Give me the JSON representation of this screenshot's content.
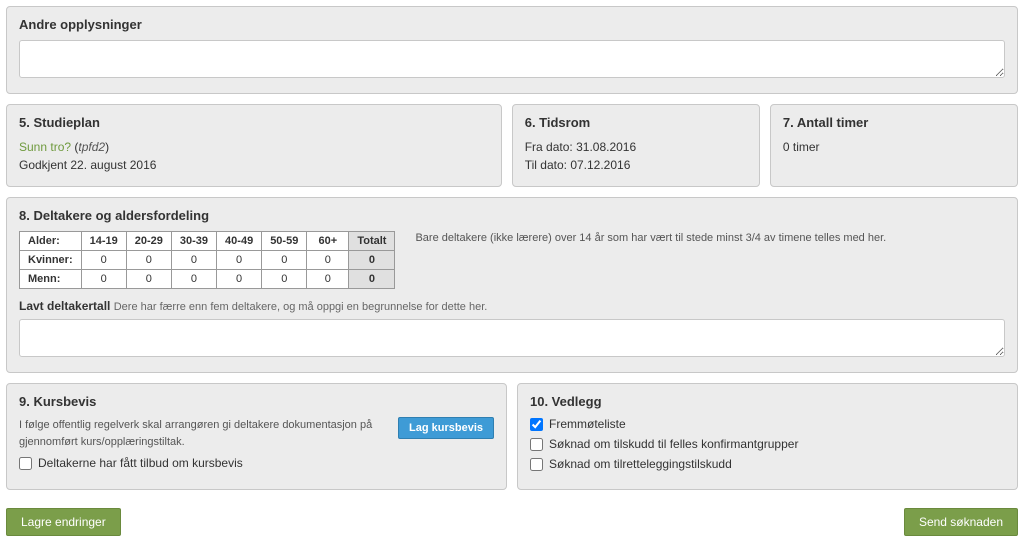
{
  "andre": {
    "title": "Andre opplysninger",
    "value": ""
  },
  "studieplan": {
    "title": "5. Studieplan",
    "linkText": "Sunn tro?",
    "code": "tpfd2",
    "approved": "Godkjent 22. august 2016"
  },
  "tidsrom": {
    "title": "6. Tidsrom",
    "fraLabel": "Fra dato:",
    "fraValue": "31.08.2016",
    "tilLabel": "Til dato:",
    "tilValue": "07.12.2016"
  },
  "antallTimer": {
    "title": "7. Antall timer",
    "value": "0 timer"
  },
  "deltakere": {
    "title": "8. Deltakere og aldersfordeling",
    "hint": "Bare deltakere (ikke lærere) over 14 år som har vært til stede minst 3/4 av timene telles med her.",
    "headers": {
      "alder": "Alder:",
      "c1": "14-19",
      "c2": "20-29",
      "c3": "30-39",
      "c4": "40-49",
      "c5": "50-59",
      "c6": "60+",
      "totalt": "Totalt"
    },
    "kvinner": {
      "label": "Kvinner:",
      "v": [
        "0",
        "0",
        "0",
        "0",
        "0",
        "0"
      ],
      "total": "0"
    },
    "menn": {
      "label": "Menn:",
      "v": [
        "0",
        "0",
        "0",
        "0",
        "0",
        "0"
      ],
      "total": "0"
    },
    "lavtLabel": "Lavt deltakertall",
    "lavtDesc": "Dere har færre enn fem deltakere, og må oppgi en begrunnelse for dette her.",
    "lavtValue": ""
  },
  "kursbevis": {
    "title": "9. Kursbevis",
    "text": "I følge offentlig regelverk skal arrangøren gi deltakere dokumentasjon på gjennomført kurs/opplæringstiltak.",
    "button": "Lag kursbevis",
    "checkLabel": "Deltakerne har fått tilbud om kursbevis"
  },
  "vedlegg": {
    "title": "10. Vedlegg",
    "items": [
      {
        "label": "Fremmøteliste",
        "checked": true
      },
      {
        "label": "Søknad om tilskudd til felles konfirmantgrupper",
        "checked": false
      },
      {
        "label": "Søknad om tilretteleggingstilskudd",
        "checked": false
      }
    ]
  },
  "footer": {
    "save": "Lagre endringer",
    "send": "Send søknaden"
  }
}
